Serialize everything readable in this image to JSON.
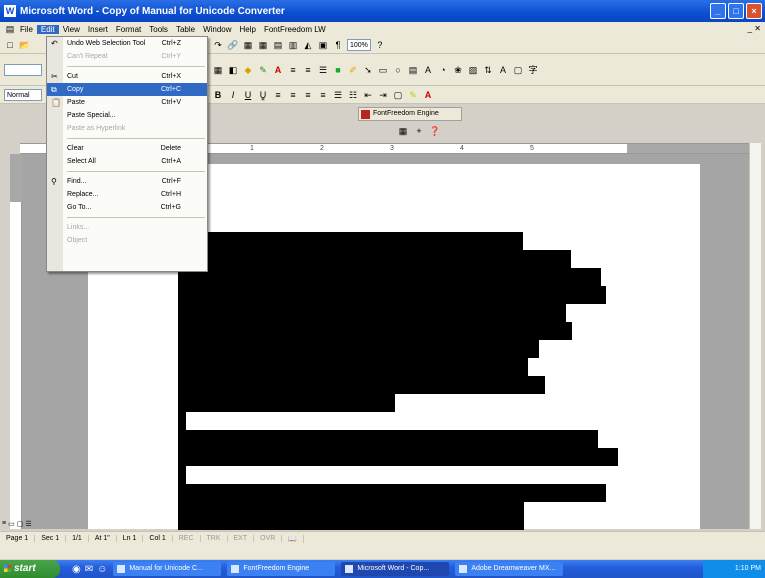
{
  "window": {
    "title": "Microsoft Word - Copy of Manual for Unicode Converter",
    "icon": "W"
  },
  "menubar": {
    "items": [
      "File",
      "Edit",
      "View",
      "Insert",
      "Format",
      "Tools",
      "Table",
      "Window",
      "Help",
      "FontFreedom LW"
    ],
    "active_index": 1
  },
  "toolbar": {
    "zoom": "100%",
    "style": "Normal"
  },
  "edit_menu": {
    "items": [
      {
        "label": "Undo Web Selection Tool",
        "shortcut": "Ctrl+Z",
        "icon": "undo-icon",
        "state": "normal"
      },
      {
        "label": "Can't Repeat",
        "shortcut": "Ctrl+Y",
        "icon": "",
        "state": "disabled"
      },
      {
        "sep": true
      },
      {
        "label": "Cut",
        "shortcut": "Ctrl+X",
        "icon": "scissors-icon",
        "state": "normal"
      },
      {
        "label": "Copy",
        "shortcut": "Ctrl+C",
        "icon": "copy-icon",
        "state": "selected"
      },
      {
        "label": "Paste",
        "shortcut": "Ctrl+V",
        "icon": "paste-icon",
        "state": "normal"
      },
      {
        "label": "Paste Special...",
        "shortcut": "",
        "icon": "",
        "state": "normal"
      },
      {
        "label": "Paste as Hyperlink",
        "shortcut": "",
        "icon": "",
        "state": "disabled"
      },
      {
        "sep": true
      },
      {
        "label": "Clear",
        "shortcut": "Delete",
        "icon": "",
        "state": "normal"
      },
      {
        "label": "Select All",
        "shortcut": "Ctrl+A",
        "icon": "",
        "state": "normal"
      },
      {
        "sep": true
      },
      {
        "label": "Find...",
        "shortcut": "Ctrl+F",
        "icon": "binoculars-icon",
        "state": "normal"
      },
      {
        "label": "Replace...",
        "shortcut": "Ctrl+H",
        "icon": "",
        "state": "normal"
      },
      {
        "label": "Go To...",
        "shortcut": "Ctrl+G",
        "icon": "",
        "state": "normal"
      },
      {
        "sep": true
      },
      {
        "label": "Links...",
        "shortcut": "",
        "icon": "",
        "state": "disabled"
      },
      {
        "label": "Object",
        "shortcut": "",
        "icon": "",
        "state": "disabled"
      }
    ]
  },
  "fontfreedom": {
    "engine_label": "FontFreedom Engine"
  },
  "ruler": {
    "marks": [
      "1",
      "2",
      "3",
      "4",
      "5"
    ]
  },
  "status": {
    "page": "Page 1",
    "sec": "Sec 1",
    "pos": "1/1",
    "at": "At 1\"",
    "ln": "Ln 1",
    "col": "Col 1",
    "modes": [
      "REC",
      "TRK",
      "EXT",
      "OVR"
    ]
  },
  "taskbar": {
    "start_label": "start",
    "tasks": [
      "Manual for Unicode C...",
      "FontFreedom Engine",
      "Microsoft Word - Cop...",
      "Adobe Dreamweaver MX..."
    ],
    "active_task": 2,
    "clock": "1:10 PM"
  },
  "colors": {
    "titlebar": "#0b4fd0",
    "selection": "#316ac5",
    "taskbar": "#245edb",
    "start": "#2f8c2f"
  }
}
